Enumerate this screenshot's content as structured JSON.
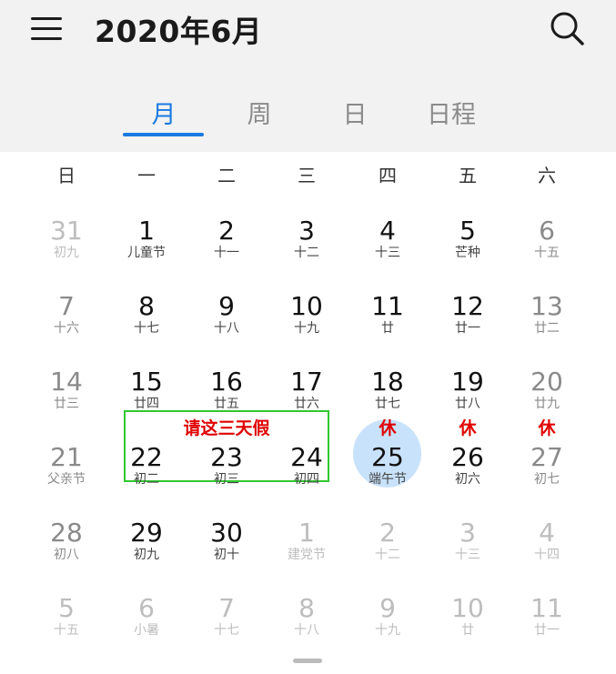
{
  "header": {
    "title": "2020年6月",
    "menu_icon": "menu-icon",
    "search_icon": "search-icon"
  },
  "tabs": [
    {
      "label": "月",
      "active": true
    },
    {
      "label": "周",
      "active": false
    },
    {
      "label": "日",
      "active": false
    },
    {
      "label": "日程",
      "active": false
    }
  ],
  "weekdays": [
    "日",
    "一",
    "二",
    "三",
    "四",
    "五",
    "六"
  ],
  "weeks": [
    [
      {
        "day": "31",
        "sub": "初九",
        "state": "other"
      },
      {
        "day": "1",
        "sub": "儿童节",
        "state": "current"
      },
      {
        "day": "2",
        "sub": "十一",
        "state": "current"
      },
      {
        "day": "3",
        "sub": "十二",
        "state": "current"
      },
      {
        "day": "4",
        "sub": "十三",
        "state": "current"
      },
      {
        "day": "5",
        "sub": "芒种",
        "state": "current"
      },
      {
        "day": "6",
        "sub": "十五",
        "state": "weekend"
      }
    ],
    [
      {
        "day": "7",
        "sub": "十六",
        "state": "weekend"
      },
      {
        "day": "8",
        "sub": "十七",
        "state": "current"
      },
      {
        "day": "9",
        "sub": "十八",
        "state": "current"
      },
      {
        "day": "10",
        "sub": "十九",
        "state": "current"
      },
      {
        "day": "11",
        "sub": "廿",
        "state": "current"
      },
      {
        "day": "12",
        "sub": "廿一",
        "state": "current"
      },
      {
        "day": "13",
        "sub": "廿二",
        "state": "weekend"
      }
    ],
    [
      {
        "day": "14",
        "sub": "廿三",
        "state": "weekend"
      },
      {
        "day": "15",
        "sub": "廿四",
        "state": "current"
      },
      {
        "day": "16",
        "sub": "廿五",
        "state": "current"
      },
      {
        "day": "17",
        "sub": "廿六",
        "state": "current"
      },
      {
        "day": "18",
        "sub": "廿七",
        "state": "current"
      },
      {
        "day": "19",
        "sub": "廿八",
        "state": "current"
      },
      {
        "day": "20",
        "sub": "廿九",
        "state": "weekend"
      }
    ],
    [
      {
        "day": "21",
        "sub": "父亲节",
        "state": "weekend"
      },
      {
        "day": "22",
        "sub": "初二",
        "state": "current"
      },
      {
        "day": "23",
        "sub": "初三",
        "state": "current"
      },
      {
        "day": "24",
        "sub": "初四",
        "state": "current"
      },
      {
        "day": "25",
        "sub": "端午节",
        "state": "current",
        "today": true,
        "holiday": "休"
      },
      {
        "day": "26",
        "sub": "初六",
        "state": "current",
        "holiday": "休"
      },
      {
        "day": "27",
        "sub": "初七",
        "state": "weekend",
        "holiday": "休"
      }
    ],
    [
      {
        "day": "28",
        "sub": "初八",
        "state": "weekend"
      },
      {
        "day": "29",
        "sub": "初九",
        "state": "current"
      },
      {
        "day": "30",
        "sub": "初十",
        "state": "current"
      },
      {
        "day": "1",
        "sub": "建党节",
        "state": "other"
      },
      {
        "day": "2",
        "sub": "十二",
        "state": "other"
      },
      {
        "day": "3",
        "sub": "十三",
        "state": "other"
      },
      {
        "day": "4",
        "sub": "十四",
        "state": "other"
      }
    ],
    [
      {
        "day": "5",
        "sub": "十五",
        "state": "other"
      },
      {
        "day": "6",
        "sub": "小暑",
        "state": "other"
      },
      {
        "day": "7",
        "sub": "十七",
        "state": "other"
      },
      {
        "day": "8",
        "sub": "十八",
        "state": "other"
      },
      {
        "day": "9",
        "sub": "十九",
        "state": "other"
      },
      {
        "day": "10",
        "sub": "廿",
        "state": "other"
      },
      {
        "day": "11",
        "sub": "廿一",
        "state": "other"
      }
    ]
  ],
  "annotation": {
    "text": "请这三天假",
    "box_color": "#2ec82e",
    "text_color": "#e00000"
  },
  "colors": {
    "accent": "#1a7ae0",
    "today_fill": "#c9e2fb",
    "holiday_mark": "#e00000"
  }
}
